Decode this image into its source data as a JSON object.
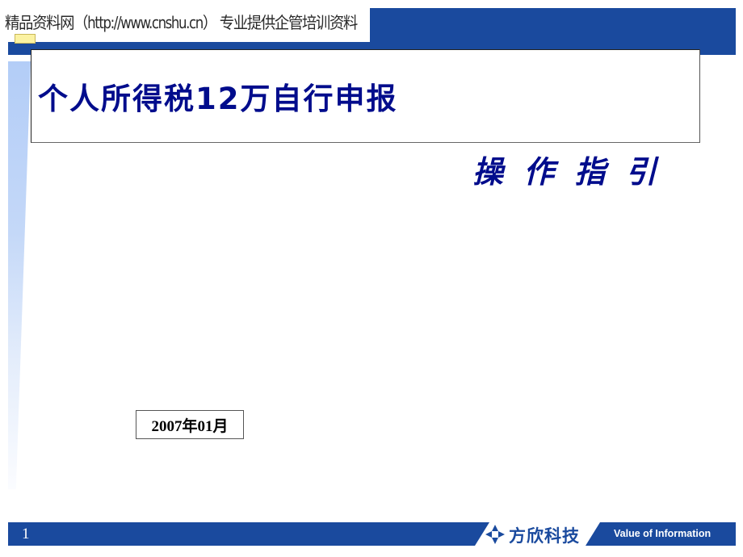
{
  "watermark": {
    "text": "精品资料网（http://www.cnshu.cn） 专业提供企管培训资料"
  },
  "slide": {
    "title": "个人所得税12万自行申报",
    "subtitle": "操 作 指 引",
    "date": "2007年01月",
    "page_number": "1"
  },
  "footer": {
    "logo_icon": "diamond-star-logo",
    "company": "方欣科技",
    "slogan": "Value of Information"
  },
  "colors": {
    "brand_blue": "#1a4a9e",
    "title_navy": "#000c8c",
    "accent_yellow": "#fbf2a2",
    "stripe_light_blue": "#b3cdf7"
  }
}
